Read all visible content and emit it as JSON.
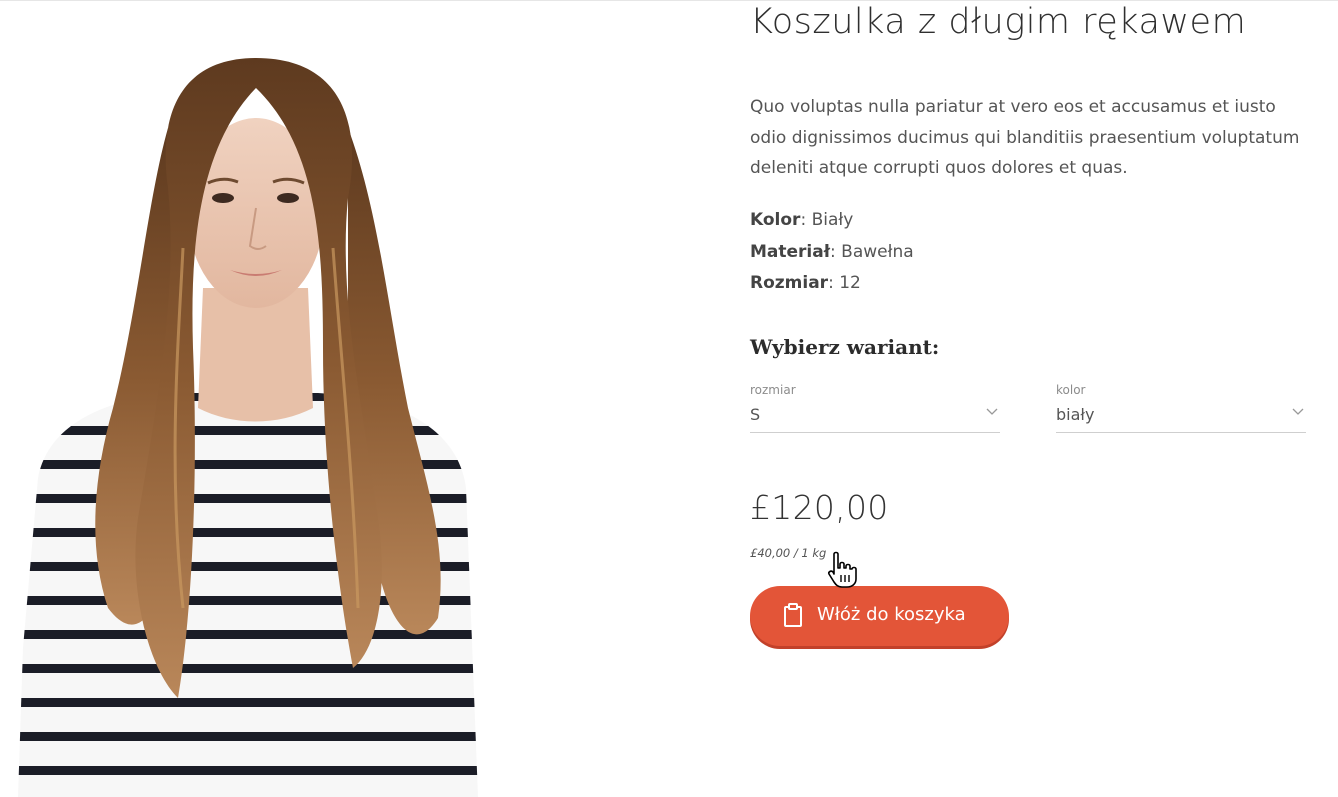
{
  "product": {
    "title": "Koszulka z długim rękawem",
    "description": "Quo voluptas nulla pariatur at vero eos et accusamus et iusto odio dignissimos ducimus qui blanditiis praesentium voluptatum deleniti atque corrupti quos dolores et quas.",
    "attributes": [
      {
        "key": "Kolor",
        "value": ": Biały"
      },
      {
        "key": "Materiał",
        "value": ": Bawełna"
      },
      {
        "key": "Rozmiar",
        "value": ": 12"
      }
    ],
    "variant_heading": "Wybierz wariant:",
    "size_select": {
      "label": "rozmiar",
      "value": "S"
    },
    "color_select": {
      "label": "kolor",
      "value": "biały"
    },
    "price": "£120,00",
    "unit_price": "£40,00 / 1 kg",
    "add_to_cart_label": "Włóż do koszyka",
    "add_to_cart_icon": "shopping-bag-icon"
  },
  "colors": {
    "accent": "#e35538",
    "text": "#555555",
    "stripe": "#1b1d27",
    "hair": "#8a5a32"
  }
}
